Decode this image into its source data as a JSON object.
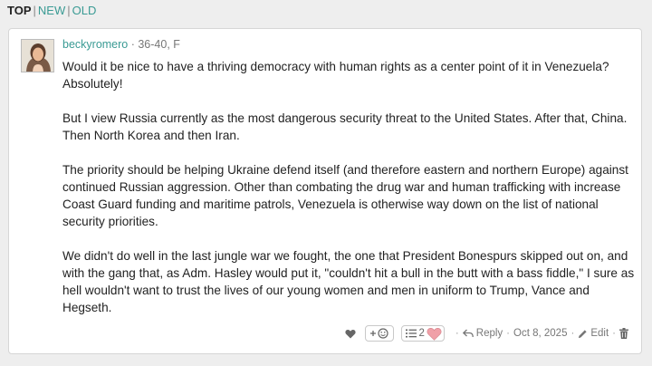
{
  "sort": {
    "top": "TOP",
    "new": "NEW",
    "old": "OLD",
    "separator": "|"
  },
  "comment": {
    "username": "beckyromero",
    "meta": " · 36-40, F",
    "paragraphs": [
      "Would it be nice to have a thriving democracy with human rights as a center point of it in Venezuela? Absolutely!",
      "But I view Russia currently as the most dangerous security threat to the United States. After that, China. Then North Korea and then Iran.",
      "The priority should be helping Ukraine defend itself (and therefore eastern and northern Europe) against continued Russian aggression. Other than combating the drug war and human trafficking with increase Coast Guard funding and maritime patrols, Venezuela is otherwise way down on the list of national security priorities.",
      "We didn't do well in the last jungle war we fought, the one that President Bonespurs skipped out on, and with the gang that, as Adm. Hasley would put it, \"couldn't hit a bull in the butt with a bass fiddle,\" I sure as hell wouldn't want to trust the lives of our young women and men in uniform to Trump, Vance and Hegseth."
    ],
    "footer": {
      "react_count": "2",
      "reply_label": "Reply",
      "date": "Oct 8, 2025",
      "edit_label": "Edit",
      "separator": "·"
    }
  },
  "icons": {
    "like": "heart-icon",
    "add_reaction": "add-emoji-icon",
    "reactions": "list-icon",
    "reply": "reply-arrow-icon",
    "edit": "pencil-icon",
    "delete": "trash-icon"
  },
  "colors": {
    "accent": "#3a9b94",
    "heart_pink": "#f0a0a8",
    "page_bg": "#eeeeee"
  }
}
